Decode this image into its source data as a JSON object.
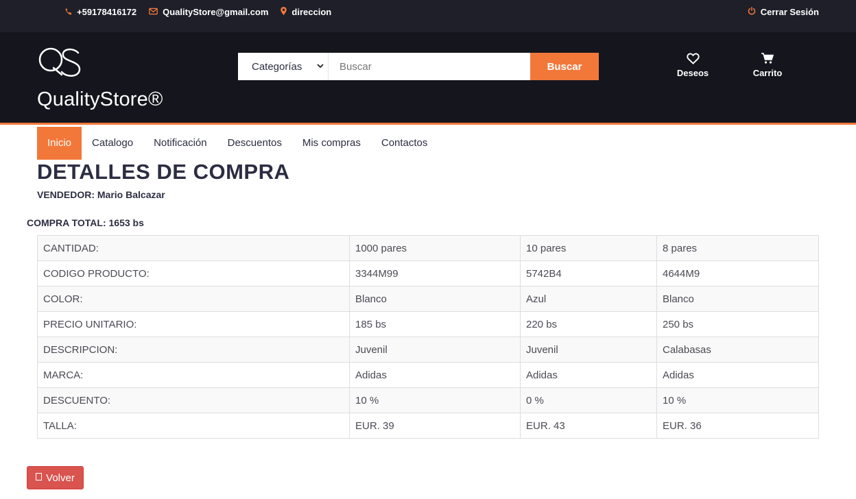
{
  "topbar": {
    "phone": "+59178416172",
    "email": "QualityStore@gmail.com",
    "address": "direccion",
    "logout": "Cerrar Sesión"
  },
  "header": {
    "brand": "QualityStore®",
    "search": {
      "category": "Categorías",
      "placeholder": "Buscar",
      "button": "Buscar"
    },
    "wishlist": "Deseos",
    "cart": "Carrito"
  },
  "nav": {
    "tabs": [
      "Inicio",
      "Catalogo",
      "Notificación",
      "Descuentos",
      "Mis compras",
      "Contactos"
    ],
    "active": "Inicio"
  },
  "main": {
    "title": "DETALLES DE COMPRA",
    "seller": "VENDEDOR: Mario Balcazar",
    "total": "COMPRA TOTAL: 1653 bs",
    "table": [
      [
        "CANTIDAD:",
        "1000 pares",
        "10 pares",
        "8 pares"
      ],
      [
        "CODIGO PRODUCTO:",
        "3344M99",
        "5742B4",
        "4644M9"
      ],
      [
        "COLOR:",
        "Blanco",
        "Azul",
        "Blanco"
      ],
      [
        "PRECIO UNITARIO:",
        "185 bs",
        "220 bs",
        "250 bs"
      ],
      [
        "DESCRIPCION:",
        "Juvenil",
        "Juvenil",
        "Calabasas"
      ],
      [
        "MARCA:",
        "Adidas",
        "Adidas",
        "Adidas"
      ],
      [
        "DESCUENTO:",
        "10 %",
        "0 %",
        "10 %"
      ],
      [
        "TALLA:",
        "EUR. 39",
        "EUR. 43",
        "EUR. 36"
      ]
    ],
    "back_button": "Volver"
  },
  "colors": {
    "accent": "#f2783a",
    "header_bg": "#15161d",
    "topbar_bg": "#1e1f29",
    "danger": "#d9534f"
  },
  "icons": [
    "phone-icon",
    "envelope-icon",
    "map-marker-icon",
    "power-icon",
    "heart-icon",
    "cart-icon",
    "back-icon"
  ]
}
